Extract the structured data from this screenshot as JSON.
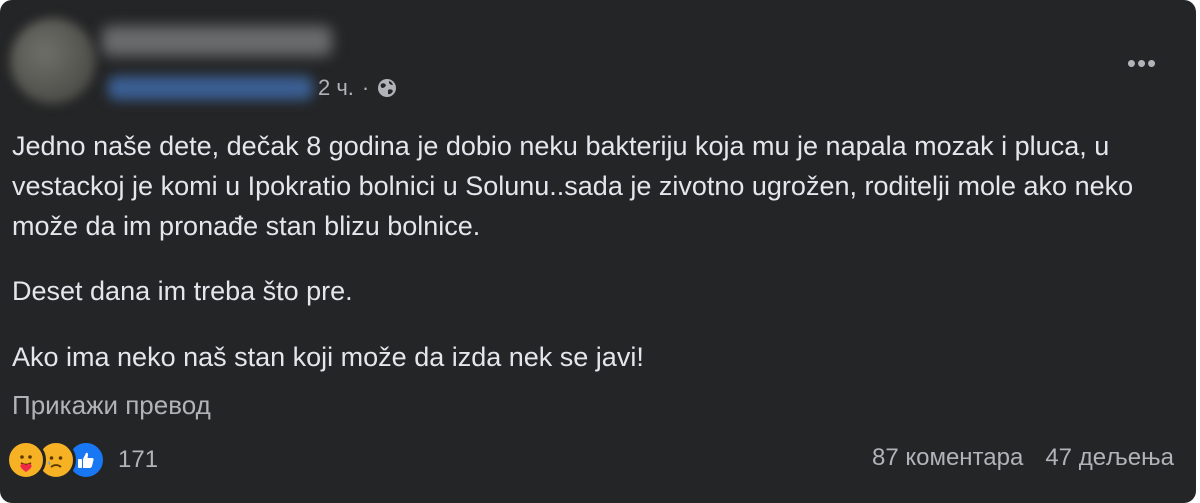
{
  "post": {
    "author": {
      "name_redacted": true,
      "avatar_redacted": true
    },
    "meta": {
      "time": "2 ч.",
      "separator": "·",
      "audience_icon": "globe-icon"
    },
    "more_icon": "more-options-icon",
    "more_label": "•••",
    "paragraphs": [
      "Jedno naše dete, dečak 8 godina je dobio neku bakteriju koja mu je napala mozak i pluca, u vestackoj je komi u Ipokratio bolnici u Solunu..sada je zivotno ugrožen, roditelji mole ako neko može da im pronađe stan blizu bolnice.",
      "Deset dana im treba što pre.",
      "Ako ima neko naš stan koji može da izda nek se javi!"
    ],
    "translate_label": "Прикажи превод",
    "reactions": {
      "types": [
        "care-reaction-icon",
        "sad-reaction-icon",
        "like-reaction-icon"
      ],
      "count": "171"
    },
    "comments_label": "87 коментара",
    "shares_label": "47 дељења"
  },
  "colors": {
    "background": "#242526",
    "primary_text": "#e4e6eb",
    "secondary_text": "#b0b3b8",
    "like_blue": "#1877f2",
    "emoji_yellow": "#f7b125"
  }
}
